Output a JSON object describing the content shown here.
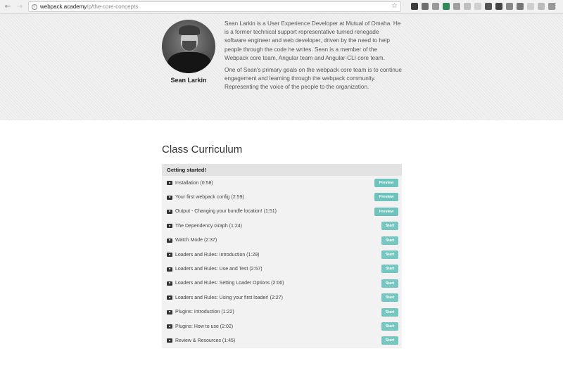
{
  "browser": {
    "url_host": "webpack.academy",
    "url_path": "/p/the-core-concepts",
    "back_icon": "arrow-left-icon",
    "forward_icon": "arrow-right-icon",
    "reload_icon": "reload-icon",
    "reload_glyph": "↻",
    "back_glyph": "←",
    "forward_glyph": "→",
    "info_glyph": "i",
    "star_glyph": "☆",
    "menu_glyph": "⋮"
  },
  "author": {
    "name": "Sean Larkin",
    "bio_paragraphs": [
      "Sean Larkin is a User Experience Developer at Mutual of Omaha. He is a former technical support representative turned renegade software engineer and web developer, driven by the need to help people through the code he writes. Sean is a member of the Webpack core team, Angular team and Angular-CLI core team.",
      "One of Sean's primary goals on the webpack core team is to continue engagement and learning through the webpack community. Representing the voice of the people to the organization."
    ]
  },
  "curriculum": {
    "title": "Class Curriculum",
    "section_title": "Getting started!",
    "lessons": [
      {
        "title": "Installation (0:58)",
        "button": "Preview"
      },
      {
        "title": "Your first webpack config (2:59)",
        "button": "Preview"
      },
      {
        "title": "Output - Changing your bundle location! (1:51)",
        "button": "Preview"
      },
      {
        "title": "The Dependency Graph (1:24)",
        "button": "Start"
      },
      {
        "title": "Watch Mode (2:37)",
        "button": "Start"
      },
      {
        "title": "Loaders and Rules: Introduction (1:29)",
        "button": "Start"
      },
      {
        "title": "Loaders and Rules: Use and Test (2:57)",
        "button": "Start"
      },
      {
        "title": "Loaders and Rules: Setting Loader Options (2:06)",
        "button": "Start"
      },
      {
        "title": "Loaders and Rules: Using your first loader! (2:27)",
        "button": "Start"
      },
      {
        "title": "Plugins: Introduction (1:22)",
        "button": "Start"
      },
      {
        "title": "Plugins: How to use (2:02)",
        "button": "Start"
      },
      {
        "title": "Review & Resources (1:45)",
        "button": "Start"
      }
    ]
  },
  "colors": {
    "accent": "#6ec4bd",
    "header_bg": "#e3e3e3",
    "author_bg": "#f1f1f1"
  }
}
